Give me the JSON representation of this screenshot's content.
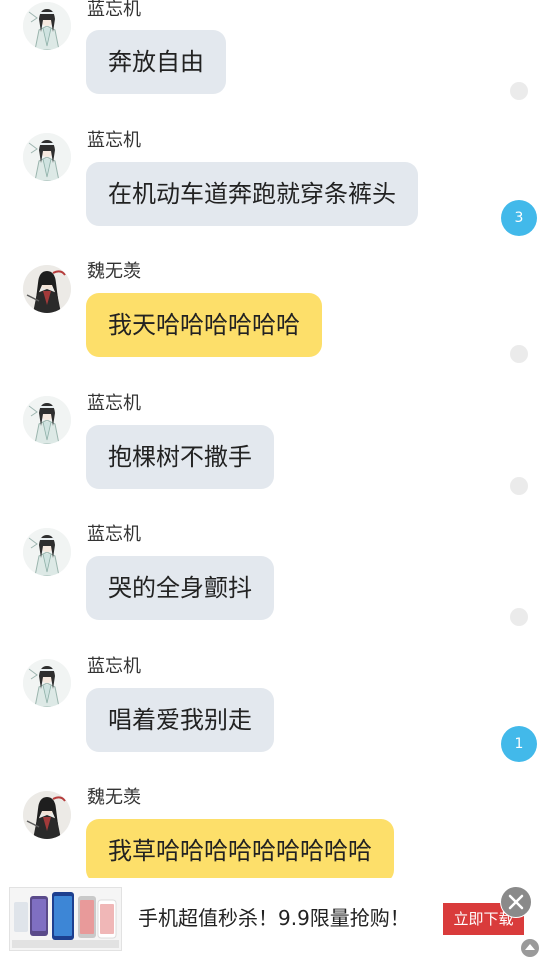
{
  "messages": [
    {
      "sender": "蓝忘机",
      "text": "奔放自由",
      "style": "blue",
      "avatar": "lan-wangji-avatar",
      "indicator": {
        "type": "dot"
      }
    },
    {
      "sender": "蓝忘机",
      "text": "在机动车道奔跑就穿条裤头",
      "style": "blue",
      "avatar": "lan-wangji-avatar",
      "indicator": {
        "type": "badge",
        "count": "3"
      }
    },
    {
      "sender": "魏无羡",
      "text": "我天哈哈哈哈哈哈",
      "style": "yellow",
      "avatar": "wei-wuxian-avatar",
      "indicator": {
        "type": "dot"
      }
    },
    {
      "sender": "蓝忘机",
      "text": "抱棵树不撒手",
      "style": "blue",
      "avatar": "lan-wangji-avatar",
      "indicator": {
        "type": "dot"
      }
    },
    {
      "sender": "蓝忘机",
      "text": "哭的全身颤抖",
      "style": "blue",
      "avatar": "lan-wangji-avatar",
      "indicator": {
        "type": "dot"
      }
    },
    {
      "sender": "蓝忘机",
      "text": "唱着爱我别走",
      "style": "blue",
      "avatar": "lan-wangji-avatar",
      "indicator": {
        "type": "badge",
        "count": "1"
      }
    },
    {
      "sender": "魏无羡",
      "text": "我草哈哈哈哈哈哈哈哈哈",
      "style": "yellow",
      "avatar": "wei-wuxian-avatar",
      "indicator": {
        "type": "none"
      }
    }
  ],
  "ad": {
    "text": "手机超值秒杀！9.9限量抢购！",
    "button_label": "立即下载",
    "close_icon": "close-icon",
    "thumbnail": "phones-thumbnail"
  },
  "colors": {
    "bubble_blue": "#e3e8ee",
    "bubble_yellow": "#fddf6a",
    "badge": "#42b9ea",
    "ad_button": "#d93b3b"
  }
}
